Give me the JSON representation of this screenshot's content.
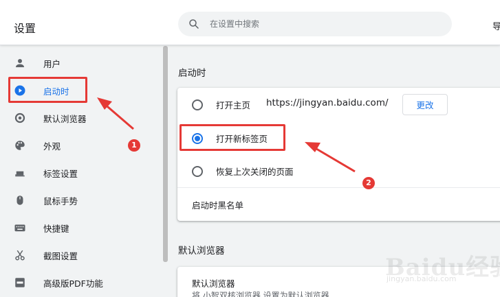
{
  "header": {
    "title": "设置",
    "search_placeholder": "在设置中搜索",
    "right_cut_text": "导"
  },
  "sidebar": {
    "items": [
      {
        "label": "用户",
        "icon": "person-icon"
      },
      {
        "label": "启动时",
        "icon": "power-play-icon",
        "active": true
      },
      {
        "label": "默认浏览器",
        "icon": "browser-circle-icon"
      },
      {
        "label": "外观",
        "icon": "palette-icon"
      },
      {
        "label": "标签设置",
        "icon": "tab-icon"
      },
      {
        "label": "鼠标手势",
        "icon": "mouse-icon"
      },
      {
        "label": "快捷键",
        "icon": "keyboard-icon"
      },
      {
        "label": "截图设置",
        "icon": "scissors-icon"
      },
      {
        "label": "高级版PDF功能",
        "icon": "pdf-icon"
      }
    ]
  },
  "startup": {
    "section_title": "启动时",
    "options": [
      {
        "label": "打开主页",
        "url": "https://jingyan.baidu.com/",
        "button": "更改",
        "checked": false
      },
      {
        "label": "打开新标签页",
        "checked": true
      },
      {
        "label": "恢复上次关闭的页面",
        "checked": false
      }
    ],
    "blacklist_label": "启动时黑名单"
  },
  "default_browser": {
    "section_title": "默认浏览器",
    "row_title": "默认浏览器",
    "row_subtitle": "将 小智双核浏览器 设置为默认浏览器"
  },
  "annotations": {
    "badge_1": "1",
    "badge_2": "2",
    "color": "#e53935"
  },
  "watermark": {
    "main": "Baidu经验",
    "sub": "jingyan.baidu.com"
  },
  "colors": {
    "accent": "#1a73e8",
    "background": "#f1f3f4",
    "card": "#ffffff"
  }
}
